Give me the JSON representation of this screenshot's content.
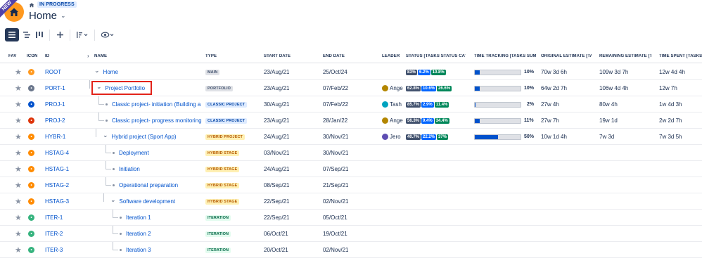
{
  "header": {
    "badge": "NEW",
    "status": "IN PROGRESS",
    "title": "Home"
  },
  "columns": {
    "fav": "FAV",
    "icon": "ICON",
    "id": "ID",
    "name": "NAME",
    "type": "TYPE",
    "start": "START DATE",
    "end": "END DATE",
    "leader": "LEADER",
    "status": "STATUS [TASKS STATUS CATE",
    "time_tracking": "TIME TRACKING [TASKS SUM]",
    "original": "ORIGINAL ESTIMATE [TAS",
    "remaining": "REMAINING ESTIMATE [TA",
    "spent": "TIME SPENT [TASKS S"
  },
  "rows": [
    {
      "id": "ROOT",
      "name": "Home",
      "type": "MAIN",
      "type_style": "main",
      "start": "23/Aug/21",
      "end": "25/Oct/24",
      "leader": "",
      "status": [
        "83%",
        "6.2%",
        "10.8%"
      ],
      "tt_pct": "10%",
      "tt_value": 10,
      "orig": "70w 3d 6h",
      "rem": "109w 3d 7h",
      "spent": "12w 4d 4h",
      "icon_color": "#ff991f"
    },
    {
      "id": "PORT-1",
      "name": "Project Portfolio",
      "type": "PORTFOLIO",
      "type_style": "portfolio",
      "start": "23/Aug/21",
      "end": "07/Feb/22",
      "leader": "Ange",
      "status": [
        "62.8%",
        "10.6%",
        "26.6%"
      ],
      "tt_pct": "10%",
      "tt_value": 10,
      "orig": "64w 2d 7h",
      "rem": "106w 4d 4h",
      "spent": "12w 7h",
      "icon_color": "#6b778c"
    },
    {
      "id": "PROJ-1",
      "name": "Classic project- initiation (Building a",
      "type": "CLASSIC PROJECT",
      "type_style": "classic",
      "start": "30/Aug/21",
      "end": "07/Feb/22",
      "leader": "Tash",
      "status": [
        "85.7%",
        "2.9%",
        "11.4%"
      ],
      "tt_pct": "2%",
      "tt_value": 2,
      "orig": "27w 4h",
      "rem": "80w 4h",
      "spent": "1w 4d 3h",
      "icon_color": "#0052cc"
    },
    {
      "id": "PROJ-2",
      "name": "Classic project- progress monitoring",
      "type": "CLASSIC PROJECT",
      "type_style": "classic",
      "start": "23/Aug/21",
      "end": "28/Jan/22",
      "leader": "Ange",
      "status": [
        "56.3%",
        "9.4%",
        "34.4%"
      ],
      "tt_pct": "11%",
      "tt_value": 11,
      "orig": "27w 7h",
      "rem": "19w 1d",
      "spent": "2w 2d 7h",
      "icon_color": "#de350b"
    },
    {
      "id": "HYBR-1",
      "name": "Hybrid project (Sport App)",
      "type": "HYBRID PROJECT",
      "type_style": "hybrid",
      "start": "24/Aug/21",
      "end": "30/Nov/21",
      "leader": "Jero",
      "status": [
        "40.7%",
        "22.2%",
        "37%"
      ],
      "tt_pct": "50%",
      "tt_value": 50,
      "orig": "10w 1d 4h",
      "rem": "7w 3d",
      "spent": "7w 3d 5h",
      "icon_color": "#ff8b00"
    },
    {
      "id": "HSTAG-4",
      "name": "Deployment",
      "type": "HYBRID STAGE",
      "type_style": "hybrid",
      "start": "03/Nov/21",
      "end": "30/Nov/21",
      "leader": "",
      "status": [],
      "tt_pct": "",
      "tt_value": null,
      "orig": "",
      "rem": "",
      "spent": "",
      "icon_color": "#ff8b00"
    },
    {
      "id": "HSTAG-1",
      "name": "Initiation",
      "type": "HYBRID STAGE",
      "type_style": "hybrid",
      "start": "24/Aug/21",
      "end": "07/Sep/21",
      "leader": "",
      "status": [],
      "tt_pct": "",
      "tt_value": null,
      "orig": "",
      "rem": "",
      "spent": "",
      "icon_color": "#ff8b00"
    },
    {
      "id": "HSTAG-2",
      "name": "Operational preparation",
      "type": "HYBRID STAGE",
      "type_style": "hybrid",
      "start": "08/Sep/21",
      "end": "21/Sep/21",
      "leader": "",
      "status": [],
      "tt_pct": "",
      "tt_value": null,
      "orig": "",
      "rem": "",
      "spent": "",
      "icon_color": "#ff8b00"
    },
    {
      "id": "HSTAG-3",
      "name": "Software development",
      "type": "HYBRID STAGE",
      "type_style": "hybrid",
      "start": "22/Sep/21",
      "end": "02/Nov/21",
      "leader": "",
      "status": [],
      "tt_pct": "",
      "tt_value": null,
      "orig": "",
      "rem": "",
      "spent": "",
      "icon_color": "#ff8b00"
    },
    {
      "id": "ITER-1",
      "name": "Iteration 1",
      "type": "ITERATION",
      "type_style": "iter",
      "start": "22/Sep/21",
      "end": "05/Oct/21",
      "leader": "",
      "status": [],
      "tt_pct": "",
      "tt_value": null,
      "orig": "",
      "rem": "",
      "spent": "",
      "icon_color": "#36b37e"
    },
    {
      "id": "ITER-2",
      "name": "Iteration 2",
      "type": "ITERATION",
      "type_style": "iter",
      "start": "06/Oct/21",
      "end": "19/Oct/21",
      "leader": "",
      "status": [],
      "tt_pct": "",
      "tt_value": null,
      "orig": "",
      "rem": "",
      "spent": "",
      "icon_color": "#36b37e"
    },
    {
      "id": "ITER-3",
      "name": "Iteration 3",
      "type": "ITERATION",
      "type_style": "iter",
      "start": "20/Oct/21",
      "end": "02/Nov/21",
      "leader": "",
      "status": [],
      "tt_pct": "",
      "tt_value": null,
      "orig": "",
      "rem": "",
      "spent": "",
      "icon_color": "#36b37e"
    }
  ]
}
